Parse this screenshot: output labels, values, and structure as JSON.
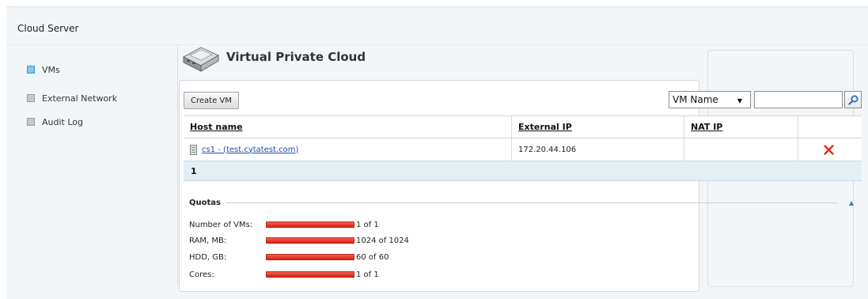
{
  "app": {
    "title": "Cloud Server"
  },
  "sidebar": {
    "items": [
      {
        "label": "VMs",
        "active": true
      },
      {
        "label": "External Network",
        "active": false
      },
      {
        "label": "Audit Log",
        "active": false
      }
    ]
  },
  "page": {
    "title": "Virtual Private Cloud",
    "icon": "server-icon"
  },
  "toolbar": {
    "create_label": "Create VM",
    "filter_selected": "VM Name",
    "search_value": "",
    "search_icon": "search-icon"
  },
  "table": {
    "columns": [
      "Host name",
      "External IP",
      "NAT IP",
      ""
    ],
    "rows": [
      {
        "host": "cs1 - (test.cytatest.com)",
        "external_ip": "172.20.44.106",
        "nat_ip": "",
        "delete_icon": "delete-x-icon"
      }
    ],
    "pager": "1"
  },
  "quotas": {
    "title": "Quotas",
    "items": [
      {
        "label": "Number of VMs:",
        "text": "1 of 1",
        "fraction": 1.0
      },
      {
        "label": "RAM, MB:",
        "text": "1024 of 1024",
        "fraction": 1.0
      },
      {
        "label": "HDD, GB:",
        "text": "60 of 60",
        "fraction": 1.0
      },
      {
        "label": "Cores:",
        "text": "1 of 1",
        "fraction": 1.0
      }
    ]
  },
  "colors": {
    "accent_blue": "#7ec7ee",
    "bar_red": "#d81f10",
    "link_blue": "#1d4fb0",
    "delete_red": "#e0301e"
  }
}
